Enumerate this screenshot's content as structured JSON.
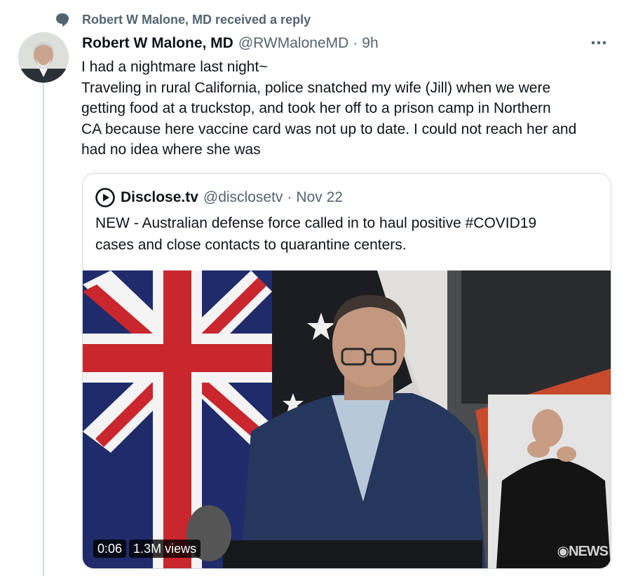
{
  "notification": {
    "icon": "speech-bubble-icon",
    "text": "Robert W Malone, MD received a reply"
  },
  "tweet": {
    "author_name": "Robert W Malone, MD",
    "handle": "@RWMaloneMD",
    "separator": "·",
    "time": "9h",
    "more_icon": "ellipsis-icon",
    "text_lines": [
      "I had a nightmare last night~",
      "Traveling in rural California, police snatched my wife (Jill) when we were",
      "getting food at a truckstop, and took her off to a prison camp in Northern",
      "CA because here vaccine card was not up to date. I could not reach her and",
      "had no idea where she was"
    ]
  },
  "quote": {
    "logo_icon": "play-circle-logo-icon",
    "author_name": "Disclose.tv",
    "handle": "@disclosetv",
    "separator": "·",
    "time": "Nov 22",
    "text_lines": [
      "NEW - Australian defense force called in to haul positive #COVID19",
      "cases and close contacts to quarantine centers."
    ],
    "video": {
      "duration": "0:06",
      "views": "1.3M views",
      "watermark": "NEWS"
    }
  },
  "colors": {
    "secondary_text": "#536471",
    "border": "#cfd9de",
    "primary_text": "#0f1419"
  }
}
